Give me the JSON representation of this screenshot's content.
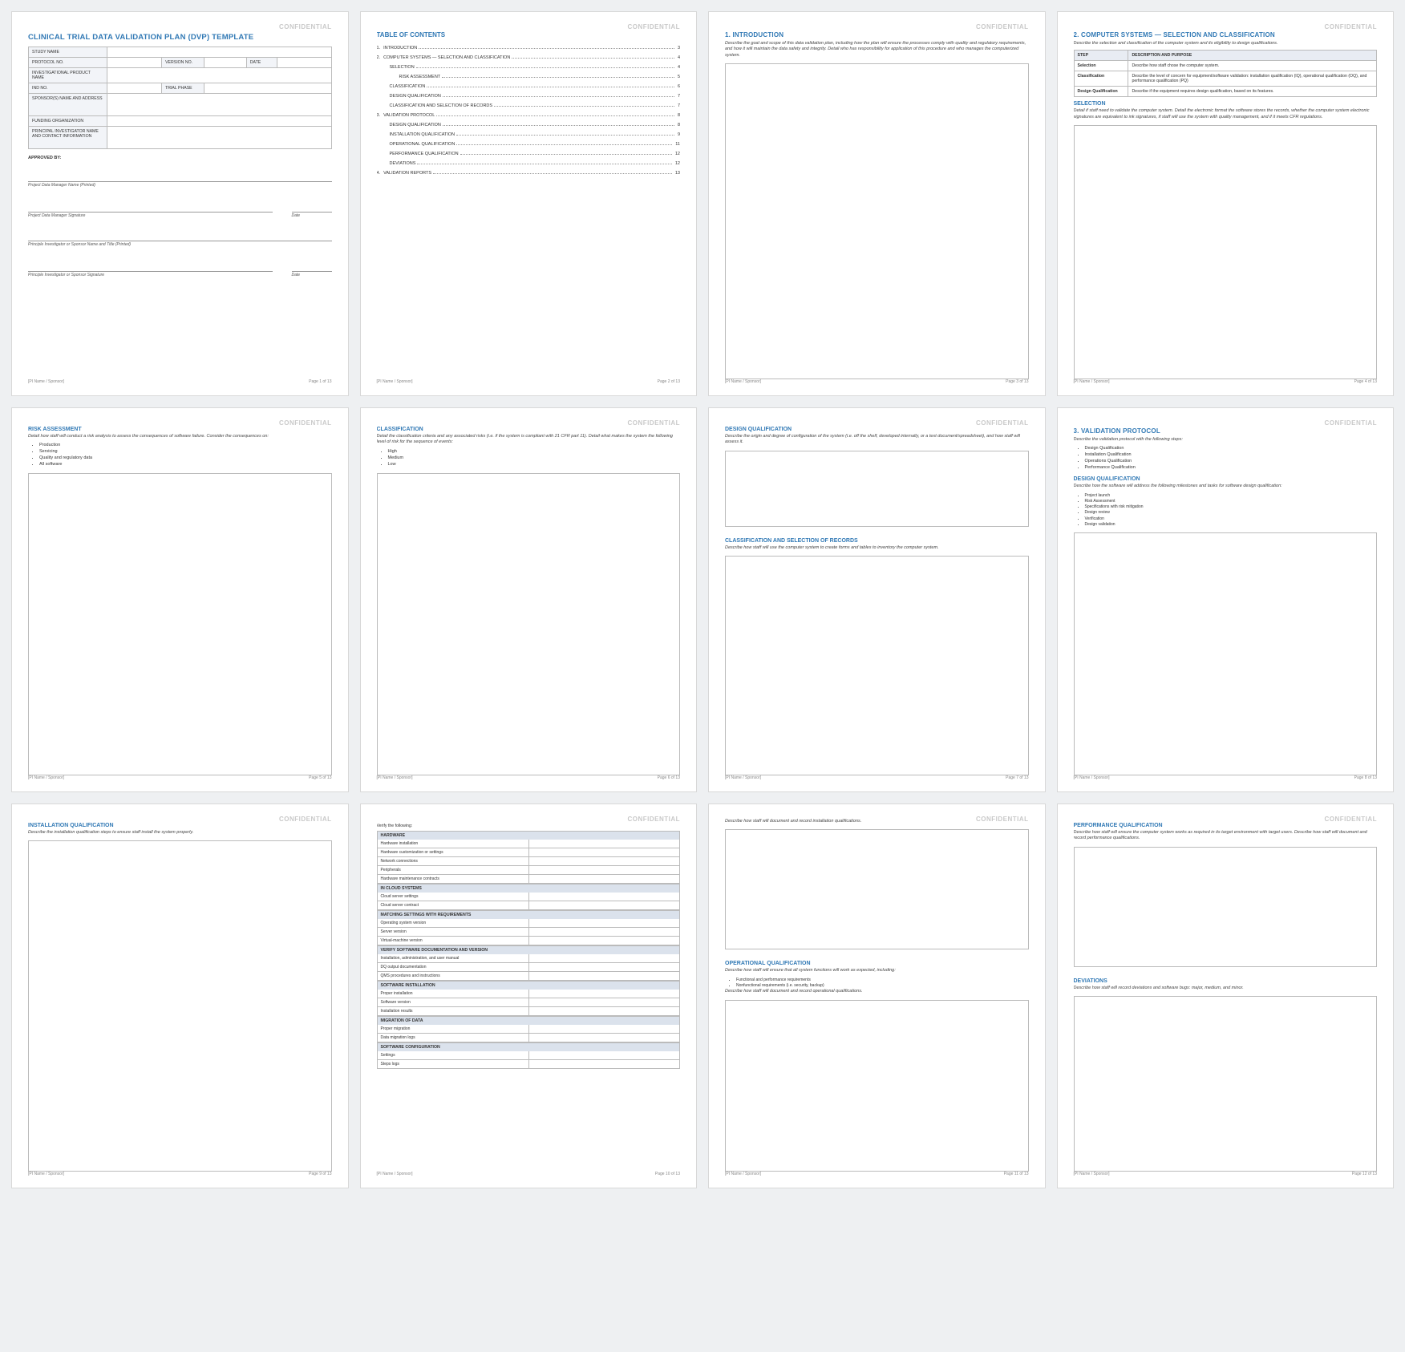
{
  "confidential": "CONFIDENTIAL",
  "footer_left": "[PI Name / Sponsor]",
  "footer_page": "Page",
  "footer_of": "of 13",
  "p1": {
    "title": "CLINICAL TRIAL DATA VALIDATION PLAN (DVP) TEMPLATE",
    "rows": [
      "STUDY NAME",
      "PROTOCOL NO.",
      "VERSION NO.",
      "DATE",
      "INVESTIGATIONAL PRODUCT NAME",
      "IND NO.",
      "TRIAL PHASE",
      "SPONSOR(S) NAME AND ADDRESS",
      "FUNDING ORGANIZATION",
      "PRINCIPAL INVESTIGATOR NAME AND CONTACT INFORMATION"
    ],
    "approved": "APPROVED BY:",
    "sig": [
      "Project Data Manager Name (Printed)",
      "Project Data Manager Signature",
      "Date",
      "Principle Investigator or Sponsor Name and Title (Printed)",
      "Principle Investigator or Sponsor Signature",
      "Date"
    ]
  },
  "p2": {
    "title": "TABLE OF CONTENTS",
    "items": [
      {
        "n": "1.",
        "t": "INTRODUCTION",
        "p": "3",
        "i": 0
      },
      {
        "n": "2.",
        "t": "COMPUTER SYSTEMS — SELECTION AND CLASSIFICATION",
        "p": "4",
        "i": 0
      },
      {
        "n": "",
        "t": "SELECTION",
        "p": "4",
        "i": 1
      },
      {
        "n": "",
        "t": "RISK ASSESSMENT",
        "p": "5",
        "i": 2
      },
      {
        "n": "",
        "t": "CLASSIFICATION",
        "p": "6",
        "i": 1
      },
      {
        "n": "",
        "t": "DESIGN QUALIFICATION",
        "p": "7",
        "i": 1
      },
      {
        "n": "",
        "t": "CLASSIFICATION AND SELECTION OF RECORDS",
        "p": "7",
        "i": 1
      },
      {
        "n": "3.",
        "t": "VALIDATION PROTOCOL",
        "p": "8",
        "i": 0
      },
      {
        "n": "",
        "t": "DESIGN QUALIFICATION",
        "p": "8",
        "i": 1
      },
      {
        "n": "",
        "t": "INSTALLATION QUALIFICATION",
        "p": "9",
        "i": 1
      },
      {
        "n": "",
        "t": "OPERATIONAL QUALIFICATION",
        "p": "11",
        "i": 1
      },
      {
        "n": "",
        "t": "PERFORMANCE QUALIFICATION",
        "p": "12",
        "i": 1
      },
      {
        "n": "",
        "t": "DEVIATIONS",
        "p": "12",
        "i": 1
      },
      {
        "n": "4.",
        "t": "VALIDATION REPORTS",
        "p": "13",
        "i": 0
      }
    ]
  },
  "p3": {
    "title": "1. INTRODUCTION",
    "desc": "Describe the goal and scope of this data validation plan, including how the plan will ensure the processes comply with quality and regulatory requirements, and how it will maintain the data safety and integrity. Detail who has responsibility for application of this procedure and who manages the computerized system."
  },
  "p4": {
    "title": "2. COMPUTER SYSTEMS — SELECTION AND CLASSIFICATION",
    "desc": "Describe the selection and classification of the computer system and its eligibility to design qualifications.",
    "th": [
      "STEP",
      "DESCRIPTION AND PURPOSE"
    ],
    "rows": [
      [
        "Selection",
        "Describe how staff chose the computer system."
      ],
      [
        "Classification",
        "Describe the level of concern for equipment/software validation: installation qualification (IQ), operational qualification (OQ), and performance qualification (PQ)"
      ],
      [
        "Design Qualification",
        "Describe if the equipment requires design qualification, based on its features."
      ]
    ],
    "sel_title": "SELECTION",
    "sel_desc": "Detail if staff need to validate the computer system. Detail the electronic format the software stores the records, whether the computer system electronic signatures are equivalent to ink signatures, if staff will use the system with quality management, and if it meets CFR regulations."
  },
  "p5": {
    "title": "RISK ASSESSMENT",
    "desc": "Detail how staff will conduct a risk analysis to assess the consequences of software failure. Consider the consequences on:",
    "items": [
      "Production",
      "Servicing",
      "Quality and regulatory data",
      "All software"
    ]
  },
  "p6": {
    "title": "CLASSIFICATION",
    "desc": "Detail the classification criteria and any associated risks (i.e. if the system is compliant with 21 CFR part 11). Detail what makes the system the following level of risk for the sequence of events:",
    "items": [
      "High",
      "Medium",
      "Low"
    ]
  },
  "p7": {
    "t1": "DESIGN QUALIFICATION",
    "d1": "Describe the origin and degree of configuration of the system (i.e. off the shelf, developed internally, or a text document/spreadsheet), and how staff will assess it.",
    "t2": "CLASSIFICATION AND SELECTION OF RECORDS",
    "d2": "Describe how staff will use the computer system to create forms and tables to inventory the computer system."
  },
  "p8": {
    "title": "3. VALIDATION PROTOCOL",
    "desc": "Describe the validation protocol with the following steps:",
    "items": [
      "Design Qualification",
      "Installation Qualification",
      "Operations Qualification",
      "Performance Qualification"
    ],
    "t2": "DESIGN QUALIFICATION",
    "d2": "Describe how the software will address the following milestones and tasks for software design qualification:",
    "items2": [
      "Project launch",
      "Risk Assessment",
      "Specifications with risk mitigation",
      "Design review",
      "Verification",
      "Design validation"
    ]
  },
  "p9": {
    "title": "INSTALLATION QUALIFICATION",
    "desc": "Describe the installation qualification steps to ensure staff install the system properly."
  },
  "p10": {
    "intro": "Verify the following:",
    "groups": [
      {
        "h": "HARDWARE",
        "r": [
          "Hardware installation",
          "Hardware customization or settings",
          "Network connections",
          "Peripherals",
          "Hardware maintenance contracts"
        ]
      },
      {
        "h": "IN CLOUD SYSTEMS",
        "r": [
          "Cloud server settings",
          "Cloud server contract"
        ]
      },
      {
        "h": "MATCHING SETTINGS WITH REQUIREMENTS",
        "r": [
          "Operating system version",
          "Server version",
          "Virtual-machine version"
        ]
      },
      {
        "h": "VERIFY SOFTWARE DOCUMENTATION AND VERSION",
        "r": [
          "Installation, administration, and user manual",
          "DQ output documentation",
          "QMS procedures and instructions"
        ]
      },
      {
        "h": "SOFTWARE INSTALLATION",
        "r": [
          "Proper installation",
          "Software version",
          "Installation results"
        ]
      },
      {
        "h": "MIGRATION OF DATA",
        "r": [
          "Proper migration",
          "Data migration logs"
        ]
      },
      {
        "h": "SOFTWARE CONFIGURATION",
        "r": [
          "Settings",
          "Steps logs"
        ]
      }
    ]
  },
  "p11": {
    "d1": "Describe how staff will document and record installation qualifications.",
    "t2": "OPERATIONAL QUALIFICATION",
    "d2": "Describe how staff will ensure that all system functions will work as expected, including:",
    "items": [
      "Functional and performance requirements",
      "Nonfunctional requirements (i.e. security, backup)"
    ],
    "d3": "Describe how staff will document and record operational qualifications."
  },
  "p12": {
    "t1": "PERFORMANCE QUALIFICATION",
    "d1": "Describe how staff will ensure the computer system works as required in its target environment with target users. Describe how staff will document and record performance qualifications.",
    "t2": "DEVIATIONS",
    "d2": "Describe how staff will record deviations and software bugs: major, medium, and minor."
  }
}
